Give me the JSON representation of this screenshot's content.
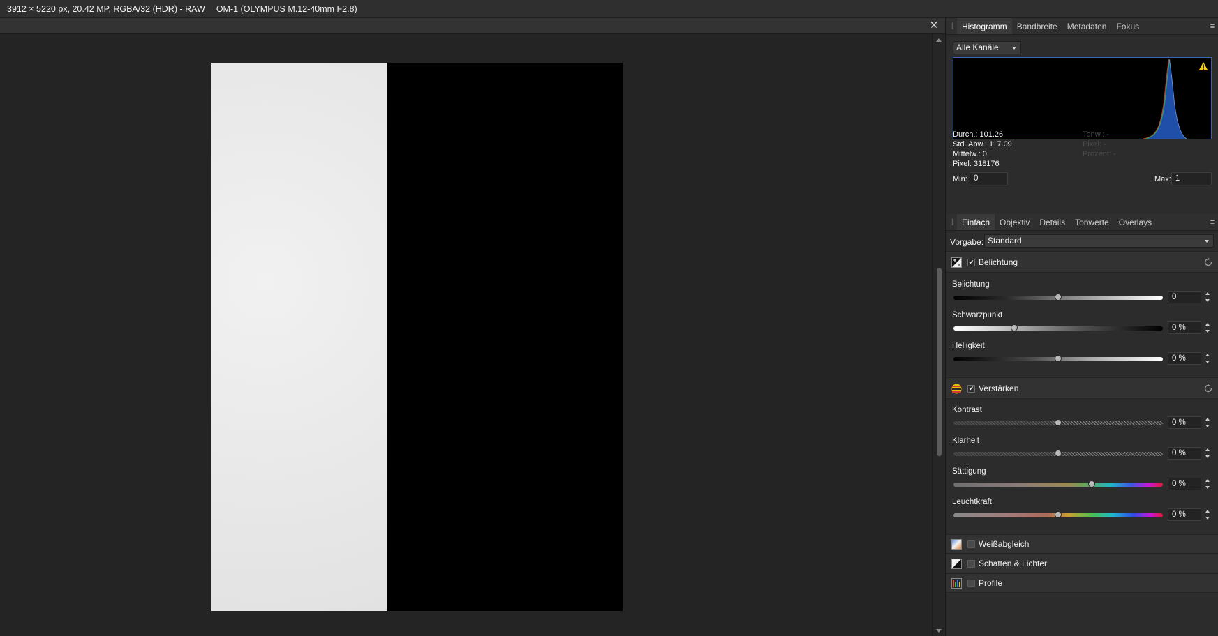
{
  "topbar": {
    "info": "3912 × 5220 px, 20.42 MP, RGBA/32 (HDR) - RAW",
    "lens": "OM-1 (OLYMPUS M.12-40mm F2.8)"
  },
  "document": {
    "close_glyph": "✕"
  },
  "histogram_panel": {
    "tabs": [
      "Histogramm",
      "Bandbreite",
      "Metadaten",
      "Fokus"
    ],
    "channel_select": "Alle Kanäle",
    "stats": {
      "mean": "Durch.: 101.26",
      "std_dev": "Std. Abw.: 117.09",
      "median": "Mittelw.: 0",
      "pixels": "Pixel: 318176",
      "tonal": "Tonw.: -",
      "px": "Pixel: -",
      "percent": "Prozent: -"
    },
    "min_label": "Min:",
    "min_value": "0",
    "max_label": "Max:",
    "max_value": "1",
    "warning_icon": "warning-icon"
  },
  "develop_panel": {
    "tabs": [
      "Einfach",
      "Objektiv",
      "Details",
      "Tonwerte",
      "Overlays"
    ],
    "preset_label": "Vorgabe:",
    "preset_value": "Standard",
    "exposure_section": {
      "title": "Belichtung",
      "enabled": true,
      "sliders": [
        {
          "label": "Belichtung",
          "value": "0",
          "pos": 0.5
        },
        {
          "label": "Schwarzpunkt",
          "value": "0 %",
          "pos": 0.29
        },
        {
          "label": "Helligkeit",
          "value": "0 %",
          "pos": 0.5
        }
      ]
    },
    "enhance_section": {
      "title": "Verstärken",
      "enabled": true,
      "sliders": [
        {
          "label": "Kontrast",
          "value": "0 %",
          "pos": 0.5
        },
        {
          "label": "Klarheit",
          "value": "0 %",
          "pos": 0.5
        },
        {
          "label": "Sättigung",
          "value": "0 %",
          "pos": 0.66
        },
        {
          "label": "Leuchtkraft",
          "value": "0 %",
          "pos": 0.5
        }
      ]
    },
    "white_balance": {
      "title": "Weißabgleich",
      "enabled": false
    },
    "shadows_highlights": {
      "title": "Schatten & Lichter",
      "enabled": false
    },
    "profiles": {
      "title": "Profile",
      "enabled": false
    }
  },
  "colors": {
    "histogram_border": "#3c62b5",
    "histogram_fill": "#1f4fa8",
    "warning": "#f5d000"
  }
}
